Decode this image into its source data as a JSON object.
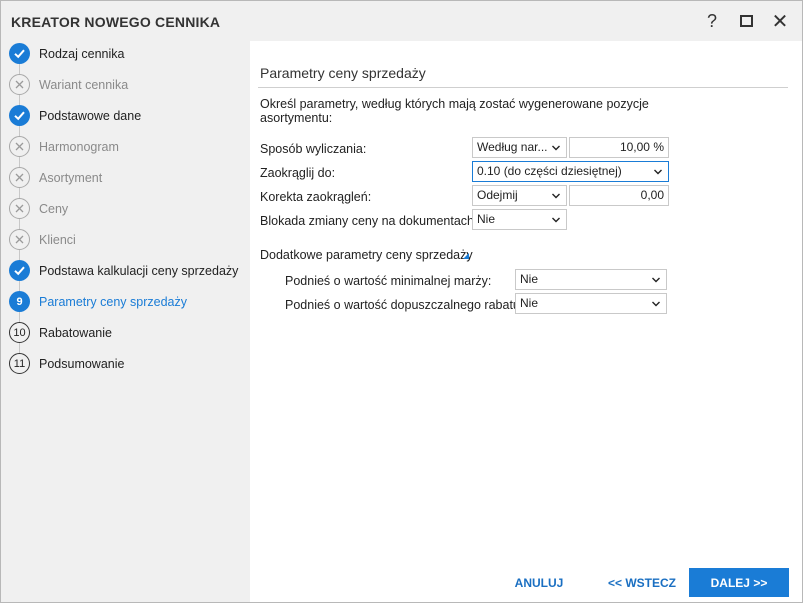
{
  "window": {
    "title": "KREATOR NOWEGO CENNIKA"
  },
  "titlebar": {
    "help": "?",
    "close": "✕"
  },
  "steps": [
    {
      "label": "Rodzaj cennika",
      "state": "done"
    },
    {
      "label": "Wariant cennika",
      "state": "skipped"
    },
    {
      "label": "Podstawowe dane",
      "state": "done"
    },
    {
      "label": "Harmonogram",
      "state": "skipped"
    },
    {
      "label": "Asortyment",
      "state": "skipped"
    },
    {
      "label": "Ceny",
      "state": "skipped"
    },
    {
      "label": "Klienci",
      "state": "skipped"
    },
    {
      "label": "Podstawa kalkulacji ceny sprzedaży",
      "state": "done"
    },
    {
      "number": "9",
      "label": "Parametry ceny sprzedaży",
      "state": "current"
    },
    {
      "number": "10",
      "label": "Rabatowanie",
      "state": "todo"
    },
    {
      "number": "11",
      "label": "Podsumowanie",
      "state": "todo"
    }
  ],
  "main": {
    "title": "Parametry ceny sprzedaży",
    "description": "Określ parametry, według których mają zostać wygenerowane pozycje asortymentu:",
    "fields": {
      "calc_method": {
        "label": "Sposób wyliczania:",
        "value": "Według nar...",
        "number": "10,00 %"
      },
      "rounding": {
        "label": "Zaokrąglij do:",
        "value": "0.10 (do części dziesiętnej)"
      },
      "rounding_correction": {
        "label": "Korekta zaokrągleń:",
        "value": "Odejmij",
        "number": "0,00"
      },
      "price_lock": {
        "label": "Blokada zmiany ceny na dokumentach:",
        "value": "Nie"
      }
    },
    "additional": {
      "title": "Dodatkowe parametry ceny sprzedaży",
      "min_margin": {
        "label": "Podnieś o wartość minimalnej marży:",
        "value": "Nie"
      },
      "allowed_discount": {
        "label": "Podnieś o wartość dopuszczalnego rabatu:",
        "value": "Nie"
      }
    }
  },
  "footer": {
    "cancel": "ANULUJ",
    "back": "<< WSTECZ",
    "next": "DALEJ >>"
  },
  "colors": {
    "accent": "#1a7cd6",
    "sidebar_bg": "#f0f0f0"
  }
}
